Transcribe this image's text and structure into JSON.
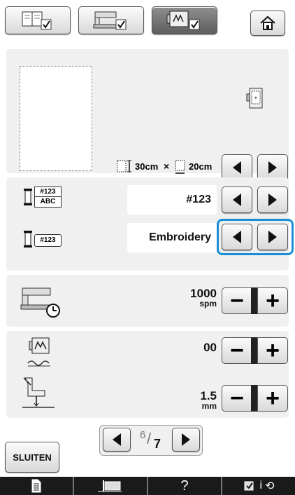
{
  "top_tabs": [
    {
      "name": "settings-page-tab",
      "icon": "book-settings-icon"
    },
    {
      "name": "machine-settings-tab",
      "icon": "sewing-machine-icon"
    },
    {
      "name": "embroidery-settings-tab",
      "icon": "embroidery-frame-icon",
      "active": true
    }
  ],
  "home_icon": "home-icon",
  "hoop_section": {
    "width_label": "30cm",
    "times": "×",
    "height_label": "20cm"
  },
  "thread_number_display": {
    "value": "#123",
    "icon_top": "#123",
    "icon_bottom": "ABC"
  },
  "thread_color_display": {
    "value": "Embroidery",
    "icon_label": "#123"
  },
  "max_speed": {
    "value": "1000",
    "unit": "spm"
  },
  "tension": {
    "value": "00"
  },
  "foot_height": {
    "value": "1.5",
    "unit": "mm"
  },
  "pager": {
    "current": "6",
    "total": "7"
  },
  "close_button": {
    "label": "SLUITEN"
  },
  "bottom_bar": [
    {
      "icon": "document-icon"
    },
    {
      "icon": "needle-position-icon"
    },
    {
      "label": "?"
    },
    {
      "icon": "info-settings-icon",
      "label": "i"
    }
  ],
  "colors": {
    "panel": "#f0f0f0",
    "highlight": "#1a8fd8",
    "active_tab": "#6f6f6f"
  }
}
